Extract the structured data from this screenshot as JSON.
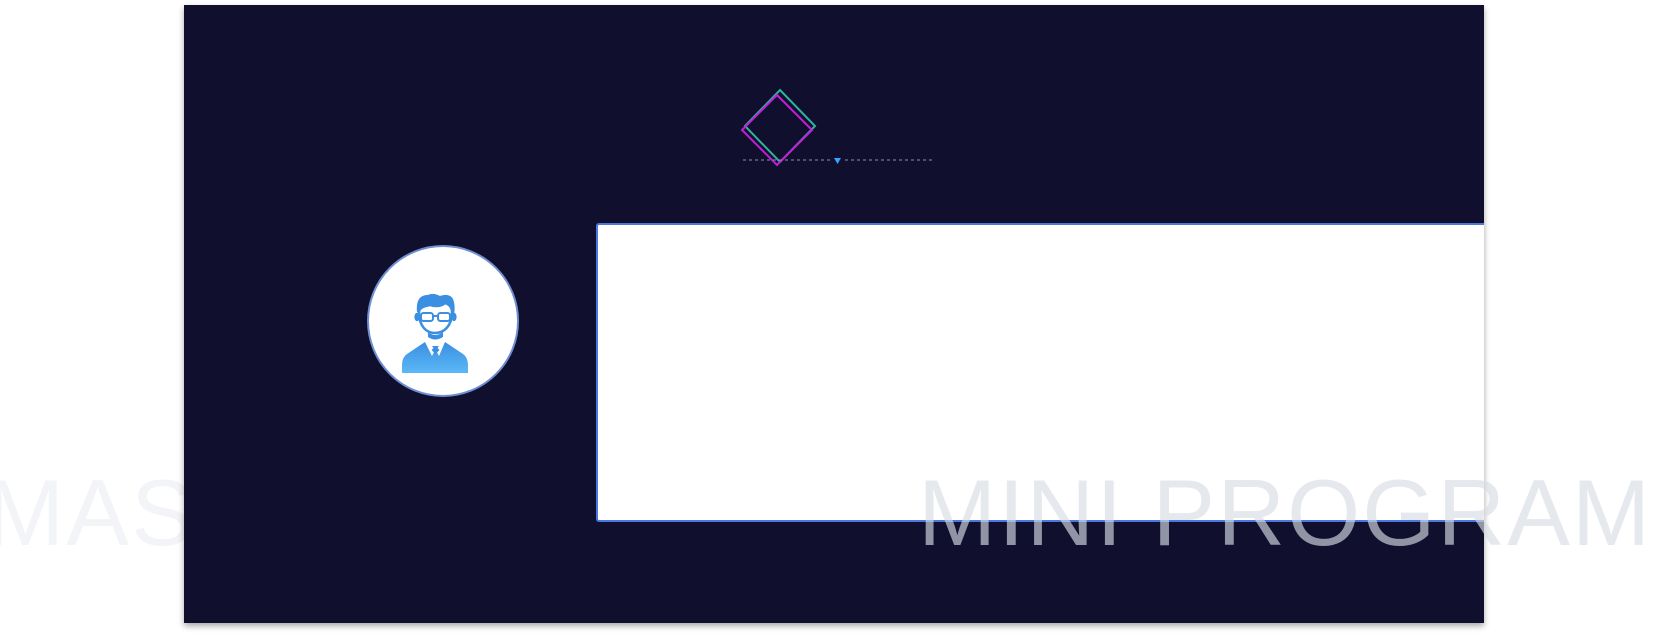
{
  "watermark": {
    "left_text": "MAS",
    "right_text": "MINI PROGRAM"
  },
  "colors": {
    "slide_background": "#110f2e",
    "diamond_outer": "#2fb39a",
    "diamond_inner": "#c21ed8",
    "divider": "#8a8fb0",
    "divider_marker": "#3aa0ff",
    "avatar_icon": "#3a9be8",
    "card_border": "#4a78e0"
  },
  "icons": {
    "diamond": "diamond-ornament-icon",
    "avatar": "user-with-glasses-icon",
    "marker": "triangle-down-icon"
  }
}
